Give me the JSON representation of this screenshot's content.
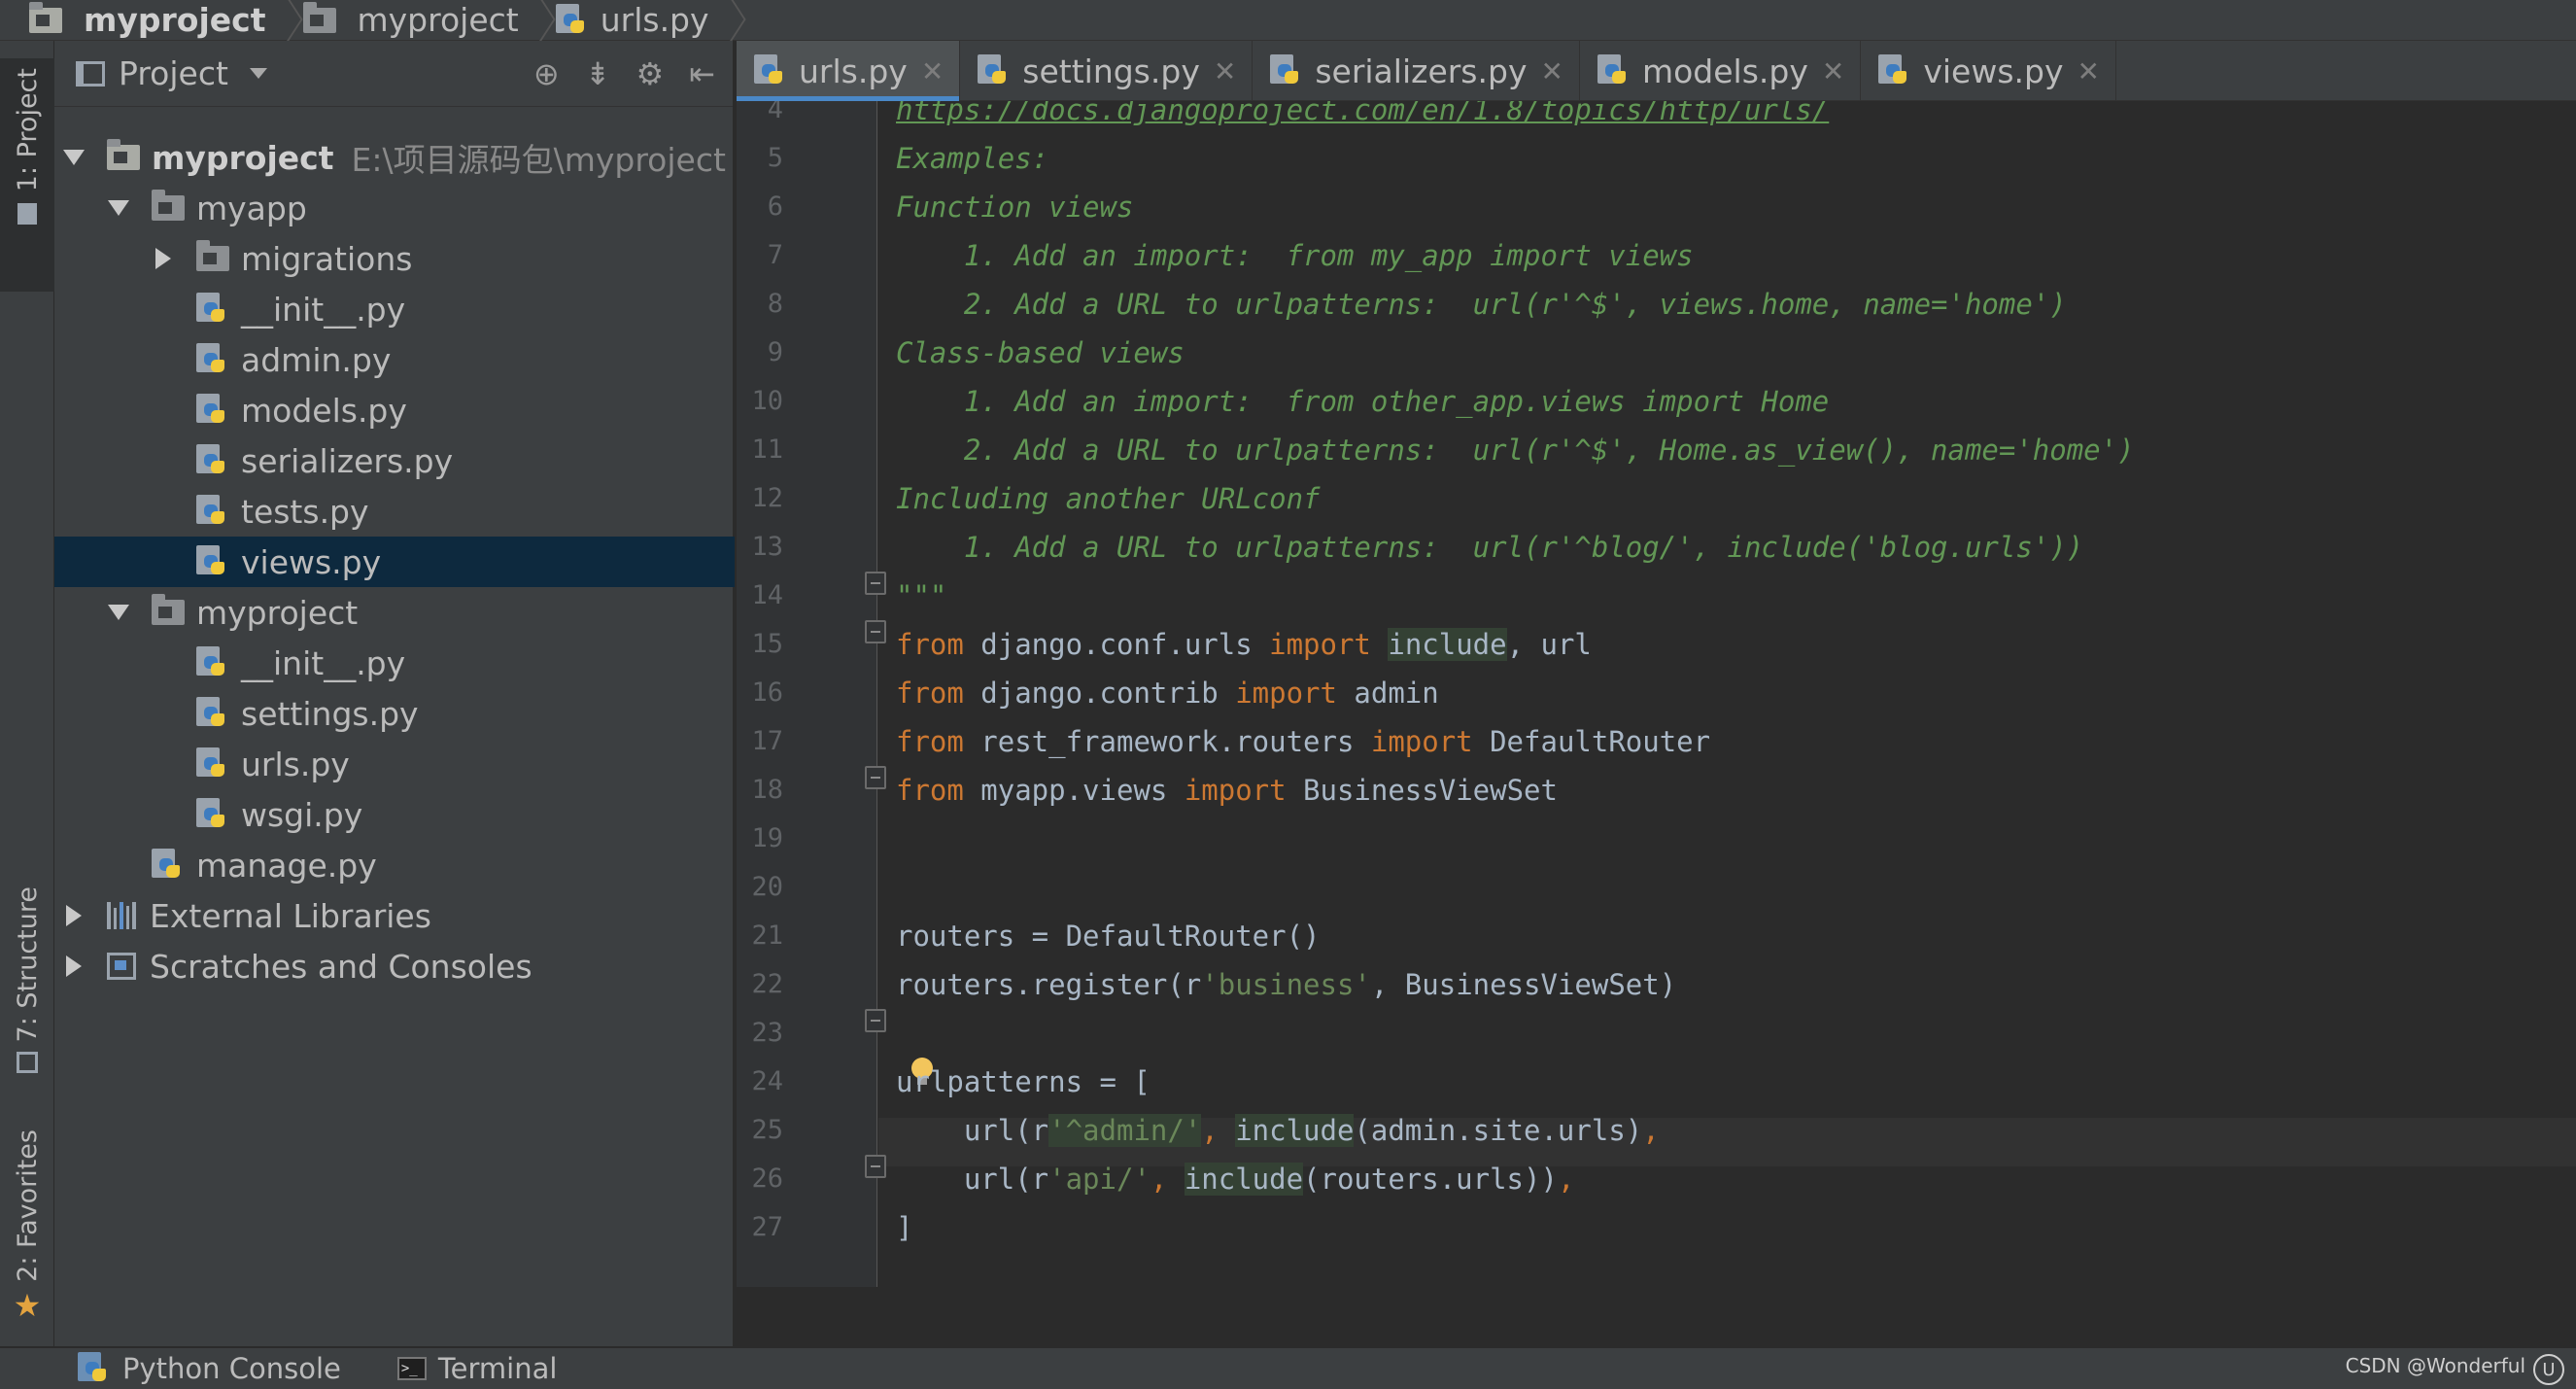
{
  "breadcrumb": [
    "myproject",
    "myproject",
    "urls.py"
  ],
  "left_strip": {
    "project_tab": "1: Project",
    "structure_tab": "7: Structure",
    "favorites_tab": "2: Favorites"
  },
  "project_panel": {
    "title": "Project",
    "tree": {
      "root_name": "myproject",
      "root_path": "E:\\项目源码包\\myproject",
      "myapp": "myapp",
      "migrations": "migrations",
      "myapp_init": "__init__.py",
      "admin": "admin.py",
      "models": "models.py",
      "serializers": "serializers.py",
      "tests": "tests.py",
      "views": "views.py",
      "myproject_pkg": "myproject",
      "pkg_init": "__init__.py",
      "settings": "settings.py",
      "urls": "urls.py",
      "wsgi": "wsgi.py",
      "manage": "manage.py",
      "external_libraries": "External Libraries",
      "scratches": "Scratches and Consoles"
    }
  },
  "tabs": [
    "urls.py",
    "settings.py",
    "serializers.py",
    "models.py",
    "views.py"
  ],
  "editor": {
    "line_numbers": [
      "4",
      "5",
      "6",
      "7",
      "8",
      "9",
      "10",
      "11",
      "12",
      "13",
      "14",
      "15",
      "16",
      "17",
      "18",
      "19",
      "20",
      "21",
      "22",
      "23",
      "24",
      "25",
      "26",
      "27"
    ],
    "line4": "https://docs.djangoproject.com/en/1.8/topics/http/urls/",
    "line5": "Examples:",
    "line6": "Function views",
    "line7": "    1. Add an import:  from my_app import views",
    "line8": "    2. Add a URL to urlpatterns:  url(r'^$', views.home, name='home')",
    "line9": "Class-based views",
    "line10": "    1. Add an import:  from other_app.views import Home",
    "line11": "    2. Add a URL to urlpatterns:  url(r'^$', Home.as_view(), name='home')",
    "line12": "Including another URLconf",
    "line13": "    1. Add a URL to urlpatterns:  url(r'^blog/', include('blog.urls'))",
    "line14": "\"\"\"",
    "kw_from": "from",
    "kw_import": "import",
    "l15_mod": " django.conf.urls ",
    "l15_include": "include",
    "l15_rest": ", url",
    "l16_mod": " django.contrib ",
    "l16_rest": " admin",
    "l17_mod": " rest_framework.routers ",
    "l17_rest": " DefaultRouter",
    "l18_mod": " myapp.views ",
    "l18_rest": " BusinessViewSet",
    "line20": "routers = DefaultRouter()",
    "l21_a": "routers.register(r",
    "l21_str": "'business'",
    "l21_b": ", BusinessViewSet)",
    "line23": "urlpatterns = [",
    "l24_a": "    url(r",
    "l24_str": "'^admin/'",
    "l24_comma": ", ",
    "l24_include": "include",
    "l24_b": "(admin.site.urls)",
    "l24_c": ",",
    "l25_a": "    url(r",
    "l25_str": "'api/'",
    "l25_comma": ", ",
    "l25_include": "include",
    "l25_b": "(routers.urls))",
    "l25_c": ",",
    "line26": "]"
  },
  "bottom_bar": {
    "python_console": "Python Console",
    "terminal": "Terminal",
    "watermark": "CSDN @Wonderful",
    "user_badge": "U"
  },
  "colors": {
    "keyword": "#cc7832",
    "string": "#6a8759",
    "docstring": "#629755",
    "selection": "#0d293e",
    "active_tab_underline": "#4a88c7"
  }
}
